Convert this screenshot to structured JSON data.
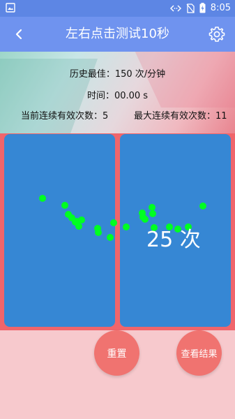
{
  "status_bar": {
    "time": "8:05",
    "left_icon": "image-icon",
    "icons": [
      "code-brackets-icon",
      "no-sim-icon",
      "battery-charging-icon"
    ]
  },
  "app_bar": {
    "title": "左右点击测试10秒",
    "back_icon": "back-chevron-icon",
    "settings_icon": "gear-icon"
  },
  "stats": {
    "best": "历史最佳：150 次/分钟",
    "time": "时间：00.00 s",
    "current_streak": "当前连续有效次数：5",
    "max_streak": "最大连续有效次数：11"
  },
  "game": {
    "count_text": "25 次",
    "pad_color": "#3687d4",
    "area_color": "#f0656b",
    "dot_color": "#00ff22"
  },
  "buttons": {
    "reset": "重置",
    "view_results": "查看结果"
  },
  "colors": {
    "status_bar": "#5d86e4",
    "app_bar": "#6f93ef",
    "button": "#f07370",
    "background": "#f7c9cd"
  }
}
